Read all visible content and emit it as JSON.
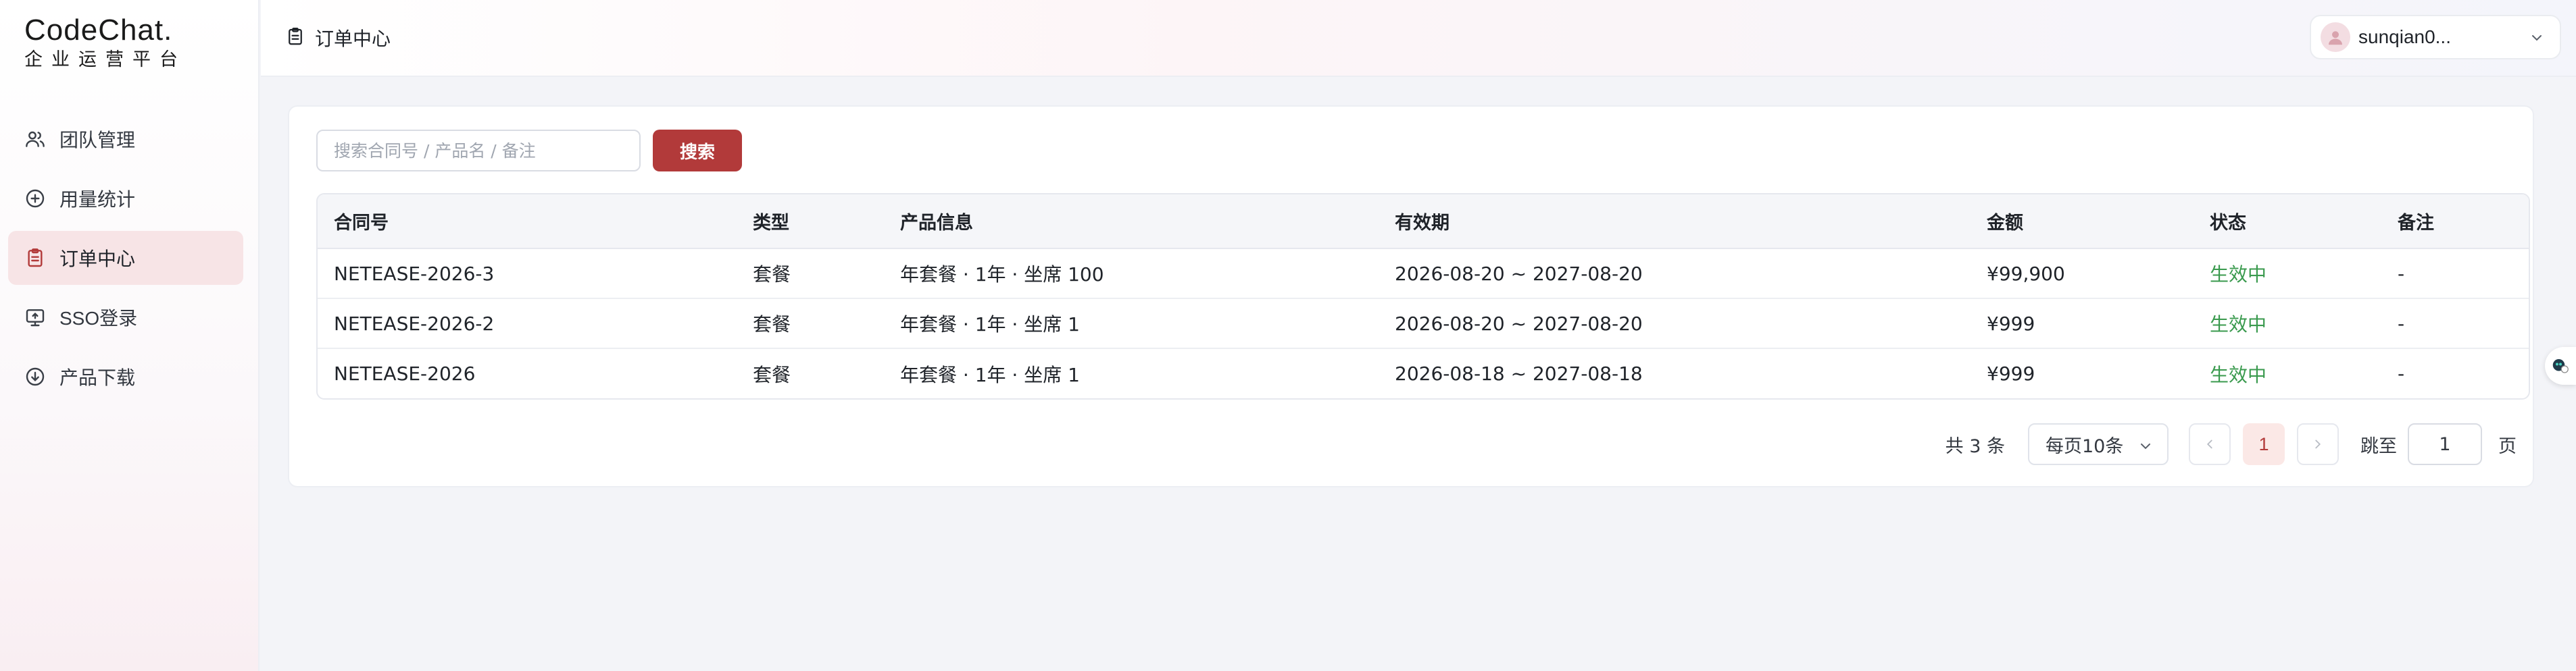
{
  "app": {
    "logo_main": "CodeChat.",
    "logo_sub": "企业运营平台"
  },
  "sidebar": {
    "items": [
      {
        "label": "团队管理",
        "icon": "users-icon",
        "active": false
      },
      {
        "label": "用量统计",
        "icon": "plus-circle-icon",
        "active": false
      },
      {
        "label": "订单中心",
        "icon": "clipboard-icon",
        "active": true
      },
      {
        "label": "SSO登录",
        "icon": "monitor-icon",
        "active": false
      },
      {
        "label": "产品下载",
        "icon": "download-circle-icon",
        "active": false
      }
    ]
  },
  "header": {
    "title": "订单中心",
    "user_name": "sunqian0..."
  },
  "search": {
    "placeholder": "搜索合同号 / 产品名 / 备注",
    "button_label": "搜索"
  },
  "table": {
    "columns": [
      "合同号",
      "类型",
      "产品信息",
      "有效期",
      "金额",
      "状态",
      "备注"
    ],
    "rows": [
      [
        "NETEASE-2026-3",
        "套餐",
        "年套餐 · 1年 · 坐席 100",
        "2026-08-20 ~ 2027-08-20",
        "¥99,900",
        "生效中",
        "-"
      ],
      [
        "NETEASE-2026-2",
        "套餐",
        "年套餐 · 1年 · 坐席 1",
        "2026-08-20 ~ 2027-08-20",
        "¥999",
        "生效中",
        "-"
      ],
      [
        "NETEASE-2026",
        "套餐",
        "年套餐 · 1年 · 坐席 1",
        "2026-08-18 ~ 2027-08-18",
        "¥999",
        "生效中",
        "-"
      ]
    ]
  },
  "pagination": {
    "total": "共 3 条",
    "page_size": "每页10条",
    "current_page": "1",
    "jump_label": "跳至",
    "jump_value": "1",
    "page_unit": "页"
  },
  "colors": {
    "accent": "#b23a3a",
    "active_nav_bg": "#f7e4e6",
    "status_active": "#3a9a4e"
  }
}
